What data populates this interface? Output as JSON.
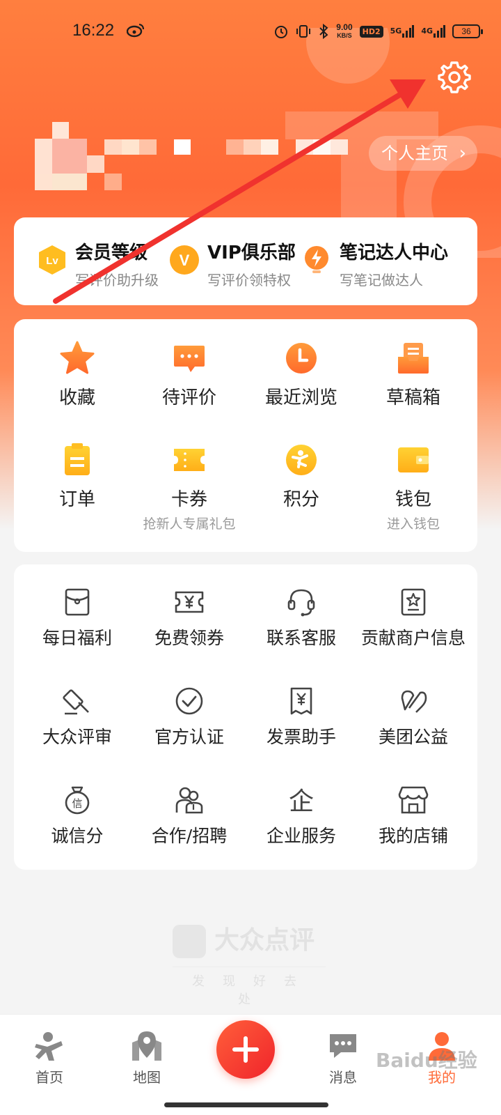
{
  "status_bar": {
    "time": "16:22",
    "speed_value": "9.00",
    "speed_unit": "KB/S",
    "hd_label": "HD2",
    "net_5g": "5G",
    "net_4g": "4G",
    "battery": "36"
  },
  "header": {
    "profile_button": "个人主页",
    "chevron": "›"
  },
  "member": {
    "items": [
      {
        "title": "会员等级",
        "subtitle": "写评价助升级",
        "icon": "level-badge-icon",
        "icon_text": "Lv"
      },
      {
        "title": "VIP俱乐部",
        "subtitle": "写评价领特权",
        "icon": "vip-badge-icon",
        "icon_text": "V"
      },
      {
        "title": "笔记达人中心",
        "subtitle": "写笔记做达人",
        "icon": "lightning-bulb-icon"
      }
    ]
  },
  "main_grid": {
    "items": [
      {
        "label": "收藏",
        "icon": "star-icon"
      },
      {
        "label": "待评价",
        "icon": "comment-icon"
      },
      {
        "label": "最近浏览",
        "icon": "clock-icon"
      },
      {
        "label": "草稿箱",
        "icon": "draft-box-icon"
      },
      {
        "label": "订单",
        "icon": "order-icon"
      },
      {
        "label": "卡券",
        "subtitle": "抢新人专属礼包",
        "icon": "coupon-icon"
      },
      {
        "label": "积分",
        "icon": "points-icon"
      },
      {
        "label": "钱包",
        "subtitle": "进入钱包",
        "icon": "wallet-icon"
      }
    ]
  },
  "tools": {
    "items": [
      {
        "label": "每日福利",
        "icon": "red-packet-icon"
      },
      {
        "label": "免费领券",
        "icon": "yen-ticket-icon"
      },
      {
        "label": "联系客服",
        "icon": "headset-icon"
      },
      {
        "label": "贡献商户信息",
        "icon": "contribute-icon"
      },
      {
        "label": "大众评审",
        "icon": "gavel-icon"
      },
      {
        "label": "官方认证",
        "icon": "verified-icon"
      },
      {
        "label": "发票助手",
        "icon": "invoice-icon"
      },
      {
        "label": "美团公益",
        "icon": "charity-icon"
      },
      {
        "label": "诚信分",
        "icon": "credit-bag-icon",
        "icon_text": "信"
      },
      {
        "label": "合作/招聘",
        "icon": "people-icon"
      },
      {
        "label": "企业服务",
        "icon": "enterprise-icon",
        "icon_text": "企"
      },
      {
        "label": "我的店铺",
        "icon": "store-icon"
      }
    ]
  },
  "footer": {
    "brand": "大众点评",
    "slogan": "发现好去处"
  },
  "tab_bar": {
    "items": [
      {
        "label": "首页",
        "icon": "home-person-icon"
      },
      {
        "label": "地图",
        "icon": "map-pin-icon"
      },
      {
        "label": "消息",
        "icon": "message-icon"
      },
      {
        "label": "我的",
        "icon": "profile-icon"
      }
    ],
    "plus": "+"
  },
  "watermark": "Baidu经验",
  "colors": {
    "brand_orange": "#ff6a38",
    "accent_yellow": "#ffc21a",
    "arrow_red": "#f0322e"
  }
}
